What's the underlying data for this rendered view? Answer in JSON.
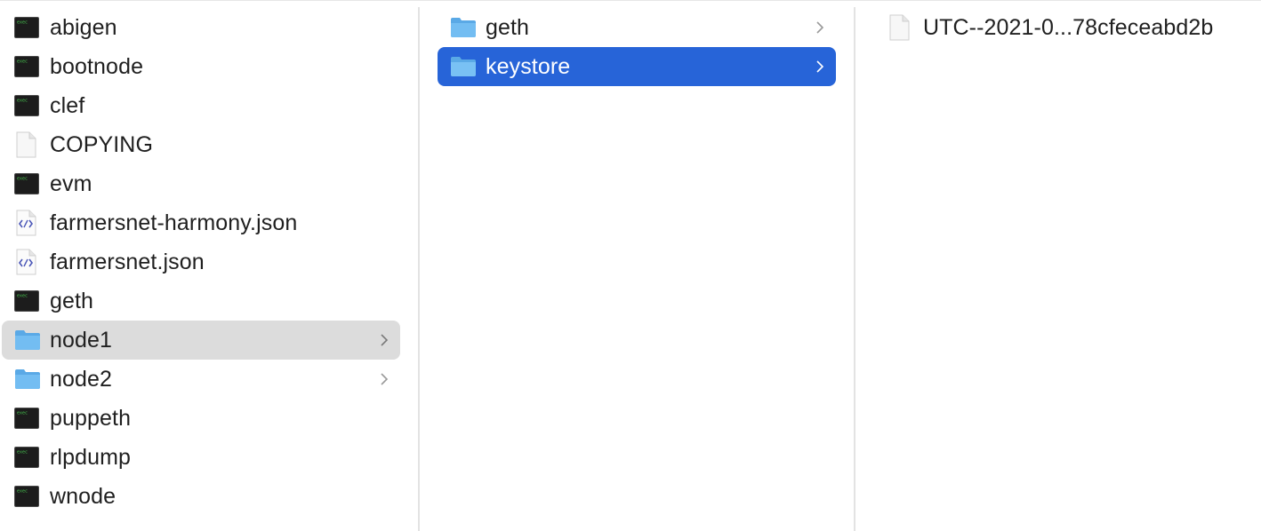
{
  "columns": [
    {
      "items": [
        {
          "name": "abigen",
          "icon": "terminal-icon",
          "exec_text": "exec"
        },
        {
          "name": "bootnode",
          "icon": "terminal-icon",
          "exec_text": "exec"
        },
        {
          "name": "clef",
          "icon": "terminal-icon",
          "exec_text": "exec"
        },
        {
          "name": "COPYING",
          "icon": "document-icon"
        },
        {
          "name": "evm",
          "icon": "terminal-icon",
          "exec_text": "exec"
        },
        {
          "name": "farmersnet-harmony.json",
          "icon": "json-file-icon"
        },
        {
          "name": "farmersnet.json",
          "icon": "json-file-icon"
        },
        {
          "name": "geth",
          "icon": "terminal-icon",
          "exec_text": "exec"
        },
        {
          "name": "node1",
          "icon": "folder-icon",
          "selected": "inactive"
        },
        {
          "name": "node2",
          "icon": "folder-icon"
        },
        {
          "name": "puppeth",
          "icon": "terminal-icon",
          "exec_text": "exec"
        },
        {
          "name": "rlpdump",
          "icon": "terminal-icon",
          "exec_text": "exec"
        },
        {
          "name": "wnode",
          "icon": "terminal-icon",
          "exec_text": "exec"
        }
      ]
    },
    {
      "items": [
        {
          "name": "geth",
          "icon": "folder-icon"
        },
        {
          "name": "keystore",
          "icon": "folder-icon",
          "selected": "active"
        }
      ]
    },
    {
      "items": [
        {
          "name": "UTC--2021-0...78cfeceabd2b",
          "icon": "document-icon"
        }
      ]
    }
  ],
  "colors": {
    "selection_active": "#2764d8",
    "selection_inactive": "#dcdcdc",
    "folder_blue": "#5fb1ec",
    "text": "#1f1f1f"
  }
}
